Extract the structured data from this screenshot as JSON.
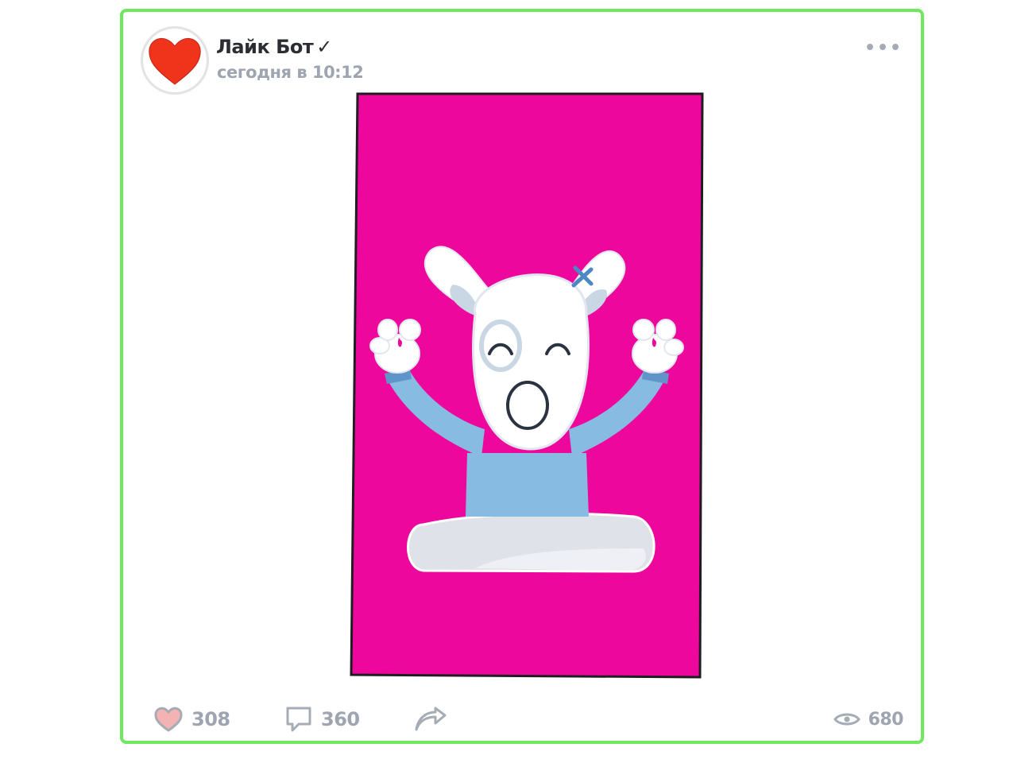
{
  "post": {
    "author": {
      "name": "Лайк Бот",
      "verified_mark": "✓",
      "avatar_icon": "heart-icon",
      "avatar_color": "#f0341c"
    },
    "time": "сегодня в 10:12",
    "menu_icon": "more-dots-icon",
    "media": {
      "background": "#ee079c",
      "subject": "dog-mascot-meditating"
    },
    "actions": {
      "likes": {
        "icon": "heart-icon",
        "count": "308"
      },
      "comments": {
        "icon": "comment-icon",
        "count": "360"
      },
      "share": {
        "icon": "share-icon"
      },
      "views": {
        "icon": "eye-icon",
        "count": "680"
      }
    }
  },
  "colors": {
    "border": "#6ee85c",
    "muted_text": "#9ea5b1",
    "title_text": "#2c2d33",
    "like_heart_fill": "#f4b3b3"
  }
}
